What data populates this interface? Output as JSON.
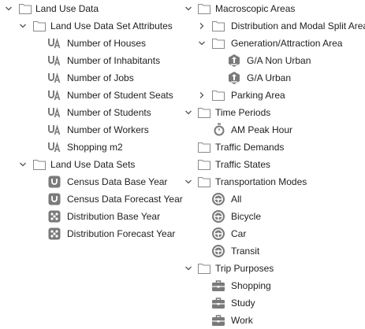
{
  "left_tree": {
    "land_use_data": {
      "label": "Land Use Data",
      "attributes_folder": {
        "label": "Land Use Data Set Attributes",
        "items": [
          "Number of Houses",
          "Number of Inhabitants",
          "Number of Jobs",
          "Number of Student Seats",
          "Number of Students",
          "Number of Workers",
          "Shopping m2"
        ]
      },
      "sets_folder": {
        "label": "Land Use Data Sets",
        "items": [
          "Census Data Base Year",
          "Census Data Forecast Year",
          "Distribution Base Year",
          "Distribution Forecast Year"
        ]
      }
    }
  },
  "right_tree": {
    "macroscopic_areas": {
      "label": "Macroscopic Areas",
      "distribution_modal_split": "Distribution and Modal Split Area",
      "generation_attraction": {
        "label": "Generation/Attraction Area",
        "items": [
          "G/A Non Urban",
          "G/A Urban"
        ]
      },
      "parking_area": "Parking Area"
    },
    "time_periods": {
      "label": "Time Periods",
      "items": [
        "AM Peak Hour"
      ]
    },
    "traffic_demands": "Traffic Demands",
    "traffic_states": "Traffic States",
    "transportation_modes": {
      "label": "Transportation Modes",
      "items": [
        "All",
        "Bicycle",
        "Car",
        "Transit"
      ]
    },
    "trip_purposes": {
      "label": "Trip Purposes",
      "items": [
        "Shopping",
        "Study",
        "Work"
      ]
    }
  },
  "colors": {
    "folder_stroke": "#8a8a8a",
    "icon_gray": "#7a7a7a",
    "chevron": "#555555",
    "text": "#1e1e1e"
  }
}
